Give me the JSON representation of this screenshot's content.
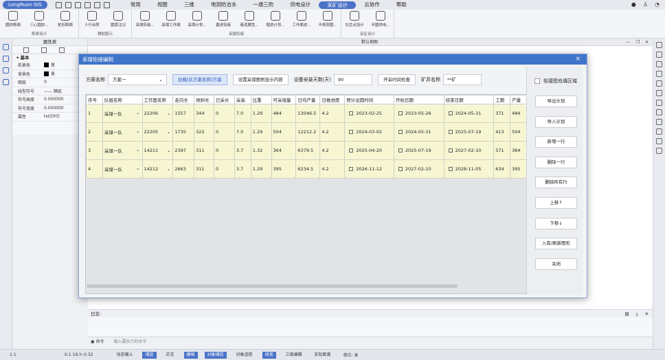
{
  "app": {
    "logo": "LongRuan GIS"
  },
  "menu": [
    "常用",
    "视图",
    "三维",
    "地测防治水",
    "一通三防",
    "供电设计",
    "采矿设计",
    "云协作",
    "帮助"
  ],
  "menu_active_index": 6,
  "ribbon": {
    "groups": [
      {
        "label": "断面设计",
        "buttons": [
          "圆拱断面",
          "三心圆拱...",
          "矩形断面"
        ]
      },
      {
        "label": "辅助图元",
        "buttons": [
          "人行台阶",
          "圆弧注记"
        ]
      },
      {
        "label": "采掘衔接",
        "buttons": [
          "采煤衔接...",
          "采煤工作面",
          "采煤计划...",
          "掘进衔接",
          "巷道属性...",
          "掘进计划...",
          "工作面进...",
          "不规则图..."
        ]
      },
      {
        "label": "采区设计",
        "buttons": [
          "交岔点设计",
          "半圆供电..."
        ]
      }
    ]
  },
  "property_panel": {
    "title": "属性表",
    "section": "基本",
    "rows": [
      {
        "key": "前景色",
        "value": "黑",
        "swatch": "#000000"
      },
      {
        "key": "背景色",
        "value": "黑",
        "swatch": "#000000"
      },
      {
        "key": "图层",
        "value": "0"
      },
      {
        "key": "线型符号",
        "value": "—— 隔底"
      },
      {
        "key": "符号高度",
        "value": "0.000000"
      },
      {
        "key": "符号宽度",
        "value": "0.000000"
      },
      {
        "key": "属性",
        "value": "txt/[00]"
      }
    ]
  },
  "doc_tab": {
    "title": "默认地图"
  },
  "dialog": {
    "title": "采煤衔接编制",
    "close": "×",
    "plan_label": "方案名称",
    "plan_value": "方案一",
    "load_btn": "加载[此方案名称]方案",
    "legend_btn": "设置采煤图例显示内容",
    "days_label": "设备安装天数(天)",
    "days_value": "90",
    "check_btn": "开采时间检查",
    "mine_label": "矿井名称",
    "mine_value": "**矿",
    "fill_check_label": "衔接图充填区域",
    "columns": [
      "序号",
      "队组名称",
      "工作面名称",
      "走向长",
      "倾斜长",
      "已采长",
      "采高",
      "比重",
      "可采储量",
      "日均产量",
      "日推进度",
      "预计出圆时间",
      "开始日期",
      "结束日期",
      "工期",
      "产量"
    ],
    "rows": [
      [
        "1",
        "采煤一队",
        "22206",
        "1557",
        "344",
        "0",
        "7.0",
        "1.29",
        "484",
        "13046.5",
        "4.2",
        "2023-02-25",
        "2023-05-26",
        "2024-05-31",
        "371",
        "484"
      ],
      [
        "2",
        "采煤一队",
        "22205",
        "1735",
        "322",
        "0",
        "7.0",
        "1.29",
        "504",
        "12212.2",
        "4.2",
        "2024-03-02",
        "2024-05-31",
        "2025-07-19",
        "413",
        "504"
      ],
      [
        "3",
        "采煤一队",
        "14211",
        "2397",
        "311",
        "0",
        "3.7",
        "1.32",
        "364",
        "6379.5",
        "4.2",
        "2025-04-20",
        "2025-07-19",
        "2027-02-10",
        "571",
        "364"
      ],
      [
        "4",
        "采煤一队",
        "14212",
        "2663",
        "311",
        "0",
        "3.7",
        "1.29",
        "395",
        "6234.5",
        "4.2",
        "2026-11-12",
        "2027-02-10",
        "2028-11-05",
        "634",
        "395"
      ]
    ],
    "side_buttons": [
      "导出计划",
      "导入计划",
      "新增一行",
      "删除一行",
      "删除所有行",
      "上移↑",
      "下移↓",
      "入库/刷新图形",
      "关闭"
    ]
  },
  "log": {
    "label": "日志:"
  },
  "command": {
    "label": "命令",
    "placeholder": "输入要执行的命令"
  },
  "status": {
    "scale": "1:1",
    "coords": "X:1.19,Y:-0.32",
    "toggles": [
      {
        "label": "动态输入",
        "on": false
      },
      {
        "label": "捕捉",
        "on": true
      },
      {
        "label": "正交",
        "on": false
      },
      {
        "label": "栅格",
        "on": true
      },
      {
        "label": "对象捕捉",
        "on": true
      },
      {
        "label": "对象追踪",
        "on": false
      },
      {
        "label": "线宽",
        "on": true
      },
      {
        "label": "三维编辑",
        "on": false
      },
      {
        "label": "实际距离",
        "on": false
      }
    ],
    "unit": "单位: 米"
  }
}
